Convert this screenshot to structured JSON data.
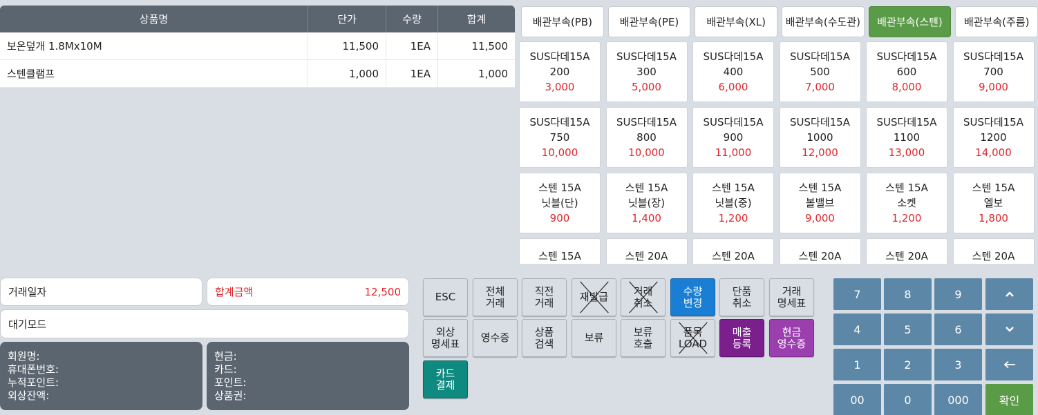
{
  "order_table": {
    "headers": {
      "name": "상품명",
      "price": "단가",
      "qty": "수량",
      "total": "합계"
    },
    "rows": [
      {
        "name": "보온덮개 1.8Mx10M",
        "price": "11,500",
        "qty": "1EA",
        "total": "11,500"
      },
      {
        "name": "스텐클램프",
        "price": "1,000",
        "qty": "1EA",
        "total": "1,000"
      }
    ]
  },
  "categories": [
    {
      "label": "배관부속(PB)",
      "active": false
    },
    {
      "label": "배관부속(PE)",
      "active": false
    },
    {
      "label": "배관부속(XL)",
      "active": false
    },
    {
      "label": "배관부속(수도관)",
      "active": false
    },
    {
      "label": "배관부속(스텐)",
      "active": true
    },
    {
      "label": "배관부속(주름)",
      "active": false
    }
  ],
  "products": [
    {
      "name": "SUS다데15A\n200",
      "price": "3,000"
    },
    {
      "name": "SUS다데15A\n300",
      "price": "5,000"
    },
    {
      "name": "SUS다데15A\n400",
      "price": "6,000"
    },
    {
      "name": "SUS다데15A\n500",
      "price": "7,000"
    },
    {
      "name": "SUS다데15A\n600",
      "price": "8,000"
    },
    {
      "name": "SUS다데15A\n700",
      "price": "9,000"
    },
    {
      "name": "SUS다데15A\n750",
      "price": "10,000"
    },
    {
      "name": "SUS다데15A\n800",
      "price": "10,000"
    },
    {
      "name": "SUS다데15A\n900",
      "price": "11,000"
    },
    {
      "name": "SUS다데15A\n1000",
      "price": "12,000"
    },
    {
      "name": "SUS다데15A\n1100",
      "price": "13,000"
    },
    {
      "name": "SUS다데15A\n1200",
      "price": "14,000"
    },
    {
      "name": "스텐 15A\n닛블(단)",
      "price": "900"
    },
    {
      "name": "스텐 15A\n닛블(장)",
      "price": "1,400"
    },
    {
      "name": "스텐 15A\n닛블(중)",
      "price": "1,200"
    },
    {
      "name": "스텐 15A\n볼밸브",
      "price": "9,000"
    },
    {
      "name": "스텐 15A\n소켓",
      "price": "1,200"
    },
    {
      "name": "스텐 15A\n엘보",
      "price": "1,800"
    },
    {
      "name": "스텐 15A",
      "price": ""
    },
    {
      "name": "스텐 20A",
      "price": ""
    },
    {
      "name": "스텐 20A",
      "price": ""
    },
    {
      "name": "스텐 20A",
      "price": ""
    },
    {
      "name": "스텐 20A",
      "price": ""
    },
    {
      "name": "스텐 20A",
      "price": ""
    }
  ],
  "info": {
    "date_label": "거래일자",
    "total_label": "합계금액",
    "total_value": "12,500",
    "mode_label": "대기모드",
    "member_lines": [
      "회원명:",
      "휴대폰번호:",
      "누적포인트:",
      "외상잔액:"
    ],
    "payment_lines": [
      "현금:",
      "카드:",
      "포인트:",
      "상품권:"
    ]
  },
  "functions": {
    "esc": "ESC",
    "all_trans": "전체\n거래",
    "last_trans": "직전\n거래",
    "reissue": "재발급",
    "cancel_trans": "거래\n취소",
    "qty_change": "수량\n변경",
    "item_cancel": "단품\n취소",
    "trans_statement": "거래\n명세표",
    "credit_statement": "외상\n명세표",
    "receipt": "영수증",
    "product_search": "상품\n검색",
    "hold": "보류",
    "hold_recall": "보류\n호출",
    "item_load": "품목\nLOAD",
    "sales_register": "매출\n등록",
    "cash_receipt": "현금\n영수증",
    "card_payment": "카드\n결제"
  },
  "keypad": {
    "k7": "7",
    "k8": "8",
    "k9": "9",
    "k4": "4",
    "k5": "5",
    "k6": "6",
    "k1": "1",
    "k2": "2",
    "k3": "3",
    "k00": "00",
    "k0": "0",
    "k000": "000",
    "confirm": "확인",
    "up_icon": "chevron-up-icon",
    "down_icon": "chevron-down-icon",
    "back_icon": "backspace-arrow-icon"
  },
  "colors": {
    "header_bg": "#5b6570",
    "active_category": "#5a9b47",
    "price_red": "#e0262b",
    "keypad_blue": "#5d87a7",
    "qty_change_blue": "#1a7fd4",
    "sales_register_purple": "#7a1f8c",
    "cash_receipt_violet": "#9b3fae",
    "card_payment_teal": "#0e8a80"
  }
}
